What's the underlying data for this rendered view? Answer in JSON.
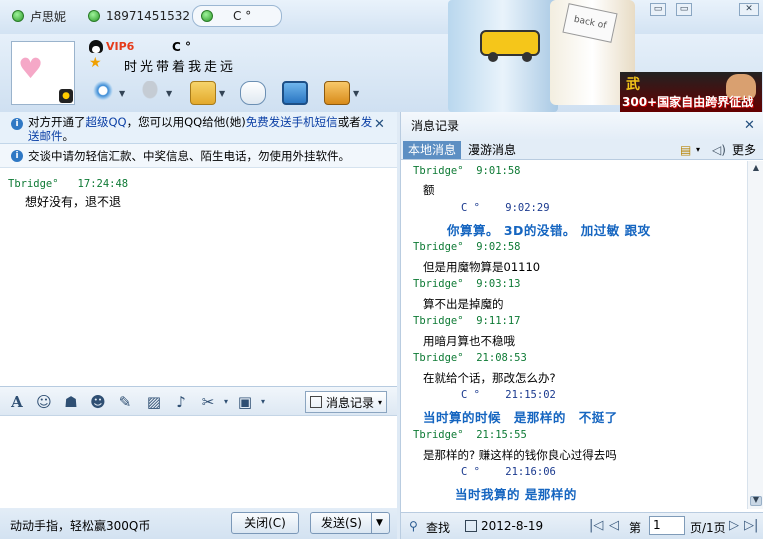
{
  "tabs": [
    {
      "label": "卢思妮",
      "status": "online"
    },
    {
      "label": "18971451532",
      "status": "online"
    },
    {
      "label": "C °",
      "status": "online",
      "selected": true
    }
  ],
  "window_buttons": {
    "min": "▭",
    "max": "▭",
    "close": "✕"
  },
  "contact": {
    "vip_label": "VIP6",
    "nickname": "C °",
    "signature": "时光带着我走远"
  },
  "ad": {
    "text": "300+国家自由跨界征战",
    "logo": "武"
  },
  "banner": {
    "book_text": "back of"
  },
  "notice1": {
    "text_a": "对方开通了",
    "link1": "超级QQ",
    "text_b": "，您可以用QQ给他(她)",
    "link2": "免费发送手机短信",
    "text_c": "或者",
    "link3": "发送邮件",
    "text_d": "。"
  },
  "notice2": {
    "text": "交谈中请勿轻信汇款、中奖信息、陌生电话，勿使用外挂软件。"
  },
  "conversation": [
    {
      "sender": "Tbridge°",
      "time": "17:24:48",
      "text": "想好没有，退不退"
    }
  ],
  "toolbar": {
    "history_label": "消息记录"
  },
  "footer": {
    "promo": "动动手指，轻松赢300Q币",
    "close_label": "关闭(C)",
    "send_label": "发送(S)"
  },
  "history": {
    "title": "消息记录",
    "tab_local": "本地消息",
    "tab_roam": "漫游消息",
    "more_label": "更多",
    "items": [
      {
        "sender": "Tbridge°",
        "time": "9:01:58",
        "text": "额",
        "mine": false
      },
      {
        "sender": "C °",
        "time": "9:02:29",
        "text": "你算算。 3D的没错。 加过敏 跟攻",
        "mine": true
      },
      {
        "sender": "Tbridge°",
        "time": "9:02:58",
        "text": "但是用魔物算是01110",
        "mine": false
      },
      {
        "sender": "Tbridge°",
        "time": "9:03:13",
        "text": "算不出是掉魔的",
        "mine": false
      },
      {
        "sender": "Tbridge°",
        "time": "9:11:17",
        "text": "用暗月算也不稳哦",
        "mine": false
      },
      {
        "sender": "Tbridge°",
        "time": "21:08:53",
        "text": "在就给个话，那改怎么办?",
        "mine": false
      },
      {
        "sender": "C °",
        "time": "21:15:02",
        "text": "当时算的时候 是那样的 不挺了",
        "mine": true
      },
      {
        "sender": "Tbridge°",
        "time": "21:15:55",
        "text": "是那样的? 赚这样的钱你良心过得去吗",
        "mine": false
      },
      {
        "sender": "C °",
        "time": "21:16:06",
        "text": "当时我算的 是那样的",
        "mine": true
      }
    ],
    "search_label": "查找",
    "date": "2012-8-19",
    "page_prefix": "第",
    "page_value": "1",
    "page_suffix": "页/1页"
  }
}
